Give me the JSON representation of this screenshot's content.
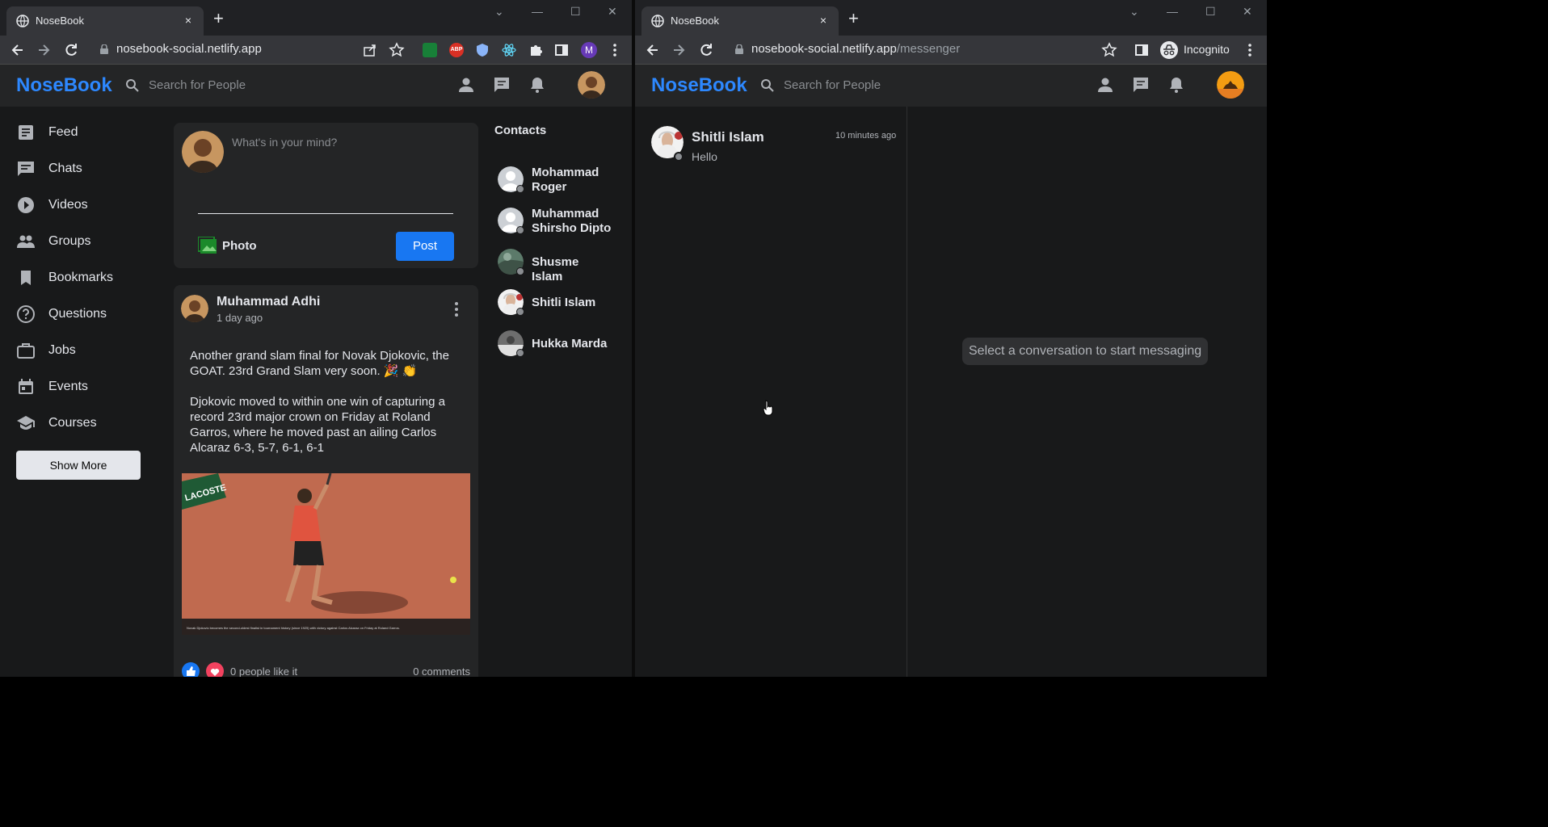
{
  "left_window": {
    "tab": {
      "title": "NoseBook",
      "close": "×"
    },
    "new_tab": "+",
    "controls": {
      "minimize": "—",
      "maximize": "☐",
      "close": "✕",
      "chevron": "⌄"
    },
    "url": {
      "host": "nosebook-social.netlify.app",
      "path": ""
    },
    "profile_initial": "M",
    "extensions": [
      "sheet-extension-icon",
      "adblock-icon",
      "shield-extension-icon",
      "react-devtools-icon",
      "puzzle-icon"
    ],
    "app": {
      "logo": "NoseBook",
      "search_placeholder": "Search for People",
      "sidebar": [
        {
          "label": "Feed",
          "icon": "feed-icon"
        },
        {
          "label": "Chats",
          "icon": "chat-icon"
        },
        {
          "label": "Videos",
          "icon": "play-icon"
        },
        {
          "label": "Groups",
          "icon": "group-icon"
        },
        {
          "label": "Bookmarks",
          "icon": "bookmark-icon"
        },
        {
          "label": "Questions",
          "icon": "question-icon"
        },
        {
          "label": "Jobs",
          "icon": "briefcase-icon"
        },
        {
          "label": "Events",
          "icon": "calendar-icon"
        },
        {
          "label": "Courses",
          "icon": "school-icon"
        }
      ],
      "show_more": "Show More",
      "composer": {
        "placeholder": "What's in your mind?",
        "photo_label": "Photo",
        "post_button": "Post"
      },
      "post": {
        "author": "Muhammad Adhi",
        "time": "1 day ago",
        "text": "Another grand slam final for Novak Djokovic, the GOAT. 23rd Grand Slam very soon. 🎉 👏\n\nDjokovic moved to within one win of capturing a record 23rd major crown on Friday at Roland Garros, where he moved past an ailing Carlos Alcaraz 6-3, 5-7, 6-1, 6-1",
        "image_sign": "LACOSTE",
        "image_caption": "Novak Djokovic becomes the second-oldest finalist in tournament history (since 1925) with victory against Carlos Alcaraz on Friday at Roland Garros.",
        "likes": "0 people like it",
        "comments": "0 comments"
      },
      "contacts_title": "Contacts",
      "contacts": [
        {
          "name": "Mohammad Roger"
        },
        {
          "name": "Muhammad Shirsho Dipto"
        },
        {
          "name": "Shusme Islam"
        },
        {
          "name": "Shitli Islam"
        },
        {
          "name": "Hukka Marda"
        }
      ]
    }
  },
  "right_window": {
    "tab": {
      "title": "NoseBook",
      "close": "×"
    },
    "new_tab": "+",
    "controls": {
      "minimize": "—",
      "maximize": "☐",
      "close": "✕",
      "chevron": "⌄"
    },
    "url": {
      "host": "nosebook-social.netlify.app",
      "path": "/messenger"
    },
    "incognito_label": "Incognito",
    "app": {
      "logo": "NoseBook",
      "search_placeholder": "Search for People",
      "conversation": {
        "name": "Shitli Islam",
        "time": "10 minutes ago",
        "last_message": "Hello"
      },
      "empty_state": "Select a conversation to start messaging"
    }
  },
  "colors": {
    "brand": "#2d88ff",
    "post_button": "#1877f2",
    "background": "#18191a",
    "surface": "#242526"
  }
}
